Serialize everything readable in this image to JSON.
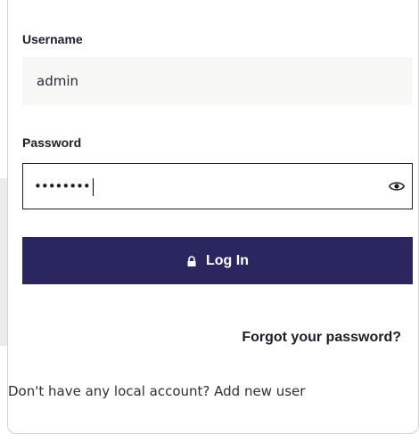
{
  "form": {
    "username_label": "Username",
    "username_value": "admin",
    "password_label": "Password",
    "password_value": "••••••••",
    "login_label": "Log In",
    "forgot_label": "Forgot your password?",
    "signup_text": "Don't have any local account?",
    "signup_link": "Add new user"
  },
  "icons": {
    "eye": "eye-icon",
    "lock": "lock-icon"
  },
  "colors": {
    "primary_button": "#2a2760",
    "input_bg": "#f7f7f6",
    "text": "#1d1d2b"
  }
}
